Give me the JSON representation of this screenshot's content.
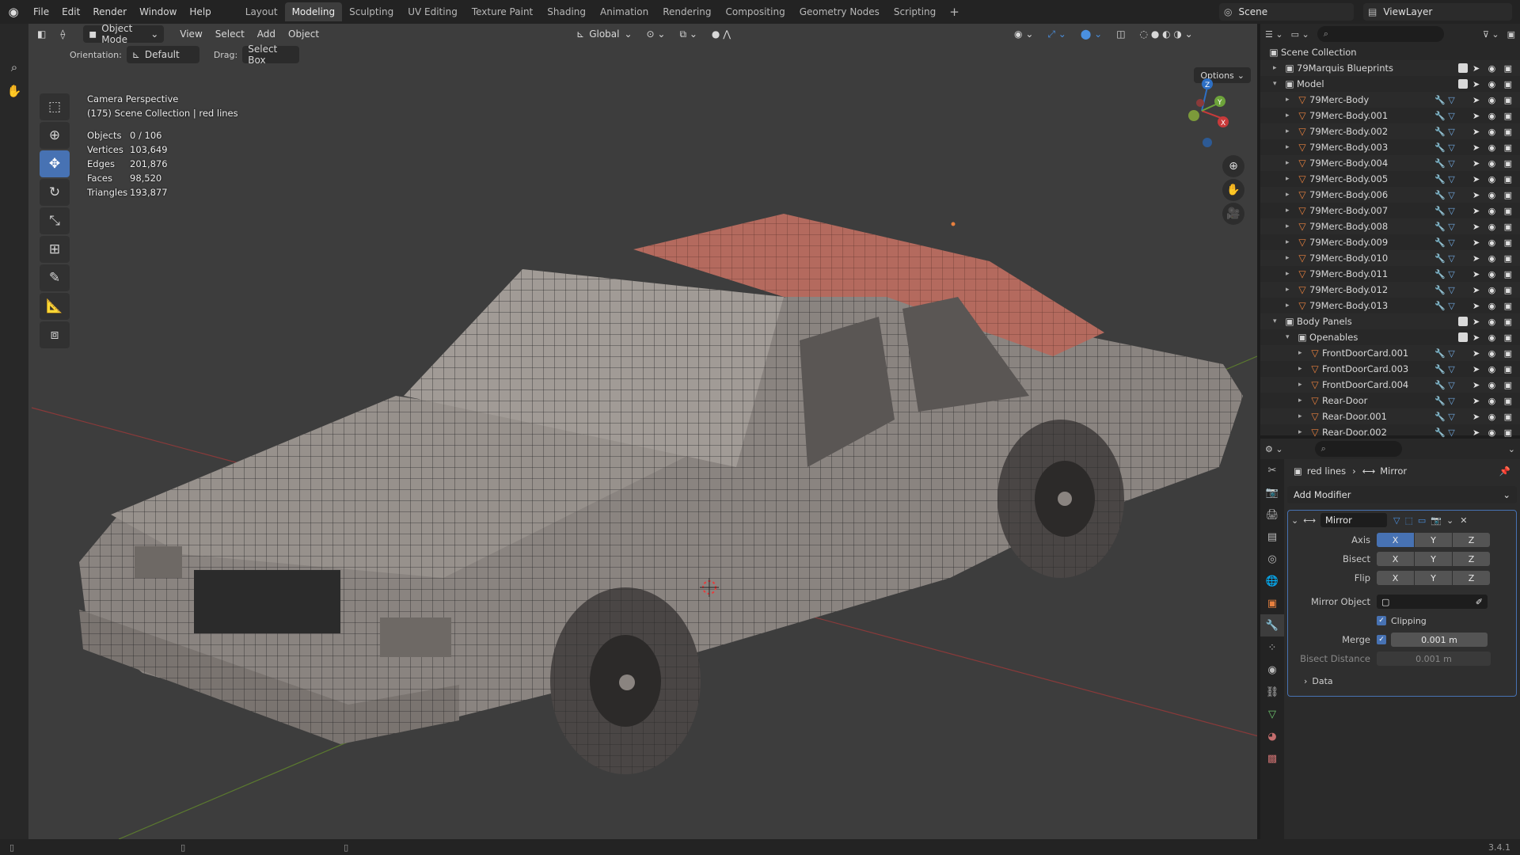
{
  "menu": [
    "File",
    "Edit",
    "Render",
    "Window",
    "Help"
  ],
  "workspaces": [
    "Layout",
    "Modeling",
    "Sculpting",
    "UV Editing",
    "Texture Paint",
    "Shading",
    "Animation",
    "Rendering",
    "Compositing",
    "Geometry Nodes",
    "Scripting"
  ],
  "active_workspace": "Modeling",
  "scene": "Scene",
  "view_layer": "ViewLayer",
  "viewport": {
    "mode": "Object Mode",
    "menus": [
      "View",
      "Select",
      "Add",
      "Object"
    ],
    "transform": "Global",
    "orientation_label": "Orientation:",
    "orientation_value": "Default",
    "drag_label": "Drag:",
    "drag_value": "Select Box",
    "options": "Options",
    "overlay_line1": "Camera Perspective",
    "overlay_line2": "(175) Scene Collection | red lines",
    "stats": [
      {
        "k": "Objects",
        "v": "0 / 106"
      },
      {
        "k": "Vertices",
        "v": "103,649"
      },
      {
        "k": "Edges",
        "v": "201,876"
      },
      {
        "k": "Faces",
        "v": "98,520"
      },
      {
        "k": "Triangles",
        "v": "193,877"
      }
    ]
  },
  "outliner": {
    "root": "Scene Collection",
    "rows": [
      {
        "indent": 1,
        "type": "coll",
        "name": "79Marquis Blueprints",
        "expanded": false,
        "check": true
      },
      {
        "indent": 1,
        "type": "coll",
        "name": "Model",
        "expanded": true,
        "check": true
      },
      {
        "indent": 2,
        "type": "obj",
        "name": "79Merc-Body"
      },
      {
        "indent": 2,
        "type": "obj",
        "name": "79Merc-Body.001"
      },
      {
        "indent": 2,
        "type": "obj",
        "name": "79Merc-Body.002"
      },
      {
        "indent": 2,
        "type": "obj",
        "name": "79Merc-Body.003"
      },
      {
        "indent": 2,
        "type": "obj",
        "name": "79Merc-Body.004"
      },
      {
        "indent": 2,
        "type": "obj",
        "name": "79Merc-Body.005"
      },
      {
        "indent": 2,
        "type": "obj",
        "name": "79Merc-Body.006"
      },
      {
        "indent": 2,
        "type": "obj",
        "name": "79Merc-Body.007"
      },
      {
        "indent": 2,
        "type": "obj",
        "name": "79Merc-Body.008"
      },
      {
        "indent": 2,
        "type": "obj",
        "name": "79Merc-Body.009"
      },
      {
        "indent": 2,
        "type": "obj",
        "name": "79Merc-Body.010"
      },
      {
        "indent": 2,
        "type": "obj",
        "name": "79Merc-Body.011"
      },
      {
        "indent": 2,
        "type": "obj",
        "name": "79Merc-Body.012"
      },
      {
        "indent": 2,
        "type": "obj",
        "name": "79Merc-Body.013"
      },
      {
        "indent": 1,
        "type": "coll",
        "name": "Body Panels",
        "expanded": true,
        "check": true
      },
      {
        "indent": 2,
        "type": "coll",
        "name": "Openables",
        "expanded": true,
        "check": true
      },
      {
        "indent": 3,
        "type": "obj",
        "name": "FrontDoorCard.001"
      },
      {
        "indent": 3,
        "type": "obj",
        "name": "FrontDoorCard.003"
      },
      {
        "indent": 3,
        "type": "obj",
        "name": "FrontDoorCard.004"
      },
      {
        "indent": 3,
        "type": "obj",
        "name": "Rear-Door"
      },
      {
        "indent": 3,
        "type": "obj",
        "name": "Rear-Door.001"
      },
      {
        "indent": 3,
        "type": "obj",
        "name": "Rear-Door.002"
      }
    ]
  },
  "properties": {
    "object": "red lines",
    "modifier": "Mirror",
    "add_modifier": "Add Modifier",
    "axis_label": "Axis",
    "bisect_label": "Bisect",
    "flip_label": "Flip",
    "axes": [
      "X",
      "Y",
      "Z"
    ],
    "mirror_object_label": "Mirror Object",
    "clipping_label": "Clipping",
    "merge_label": "Merge",
    "merge_value": "0.001 m",
    "bisect_distance_label": "Bisect Distance",
    "bisect_distance_value": "0.001 m",
    "data_label": "Data"
  },
  "version": "3.4.1",
  "colors": {
    "accent": "#4772b3",
    "object_orange": "#e8803e",
    "roof_red": "#b46a5e"
  }
}
